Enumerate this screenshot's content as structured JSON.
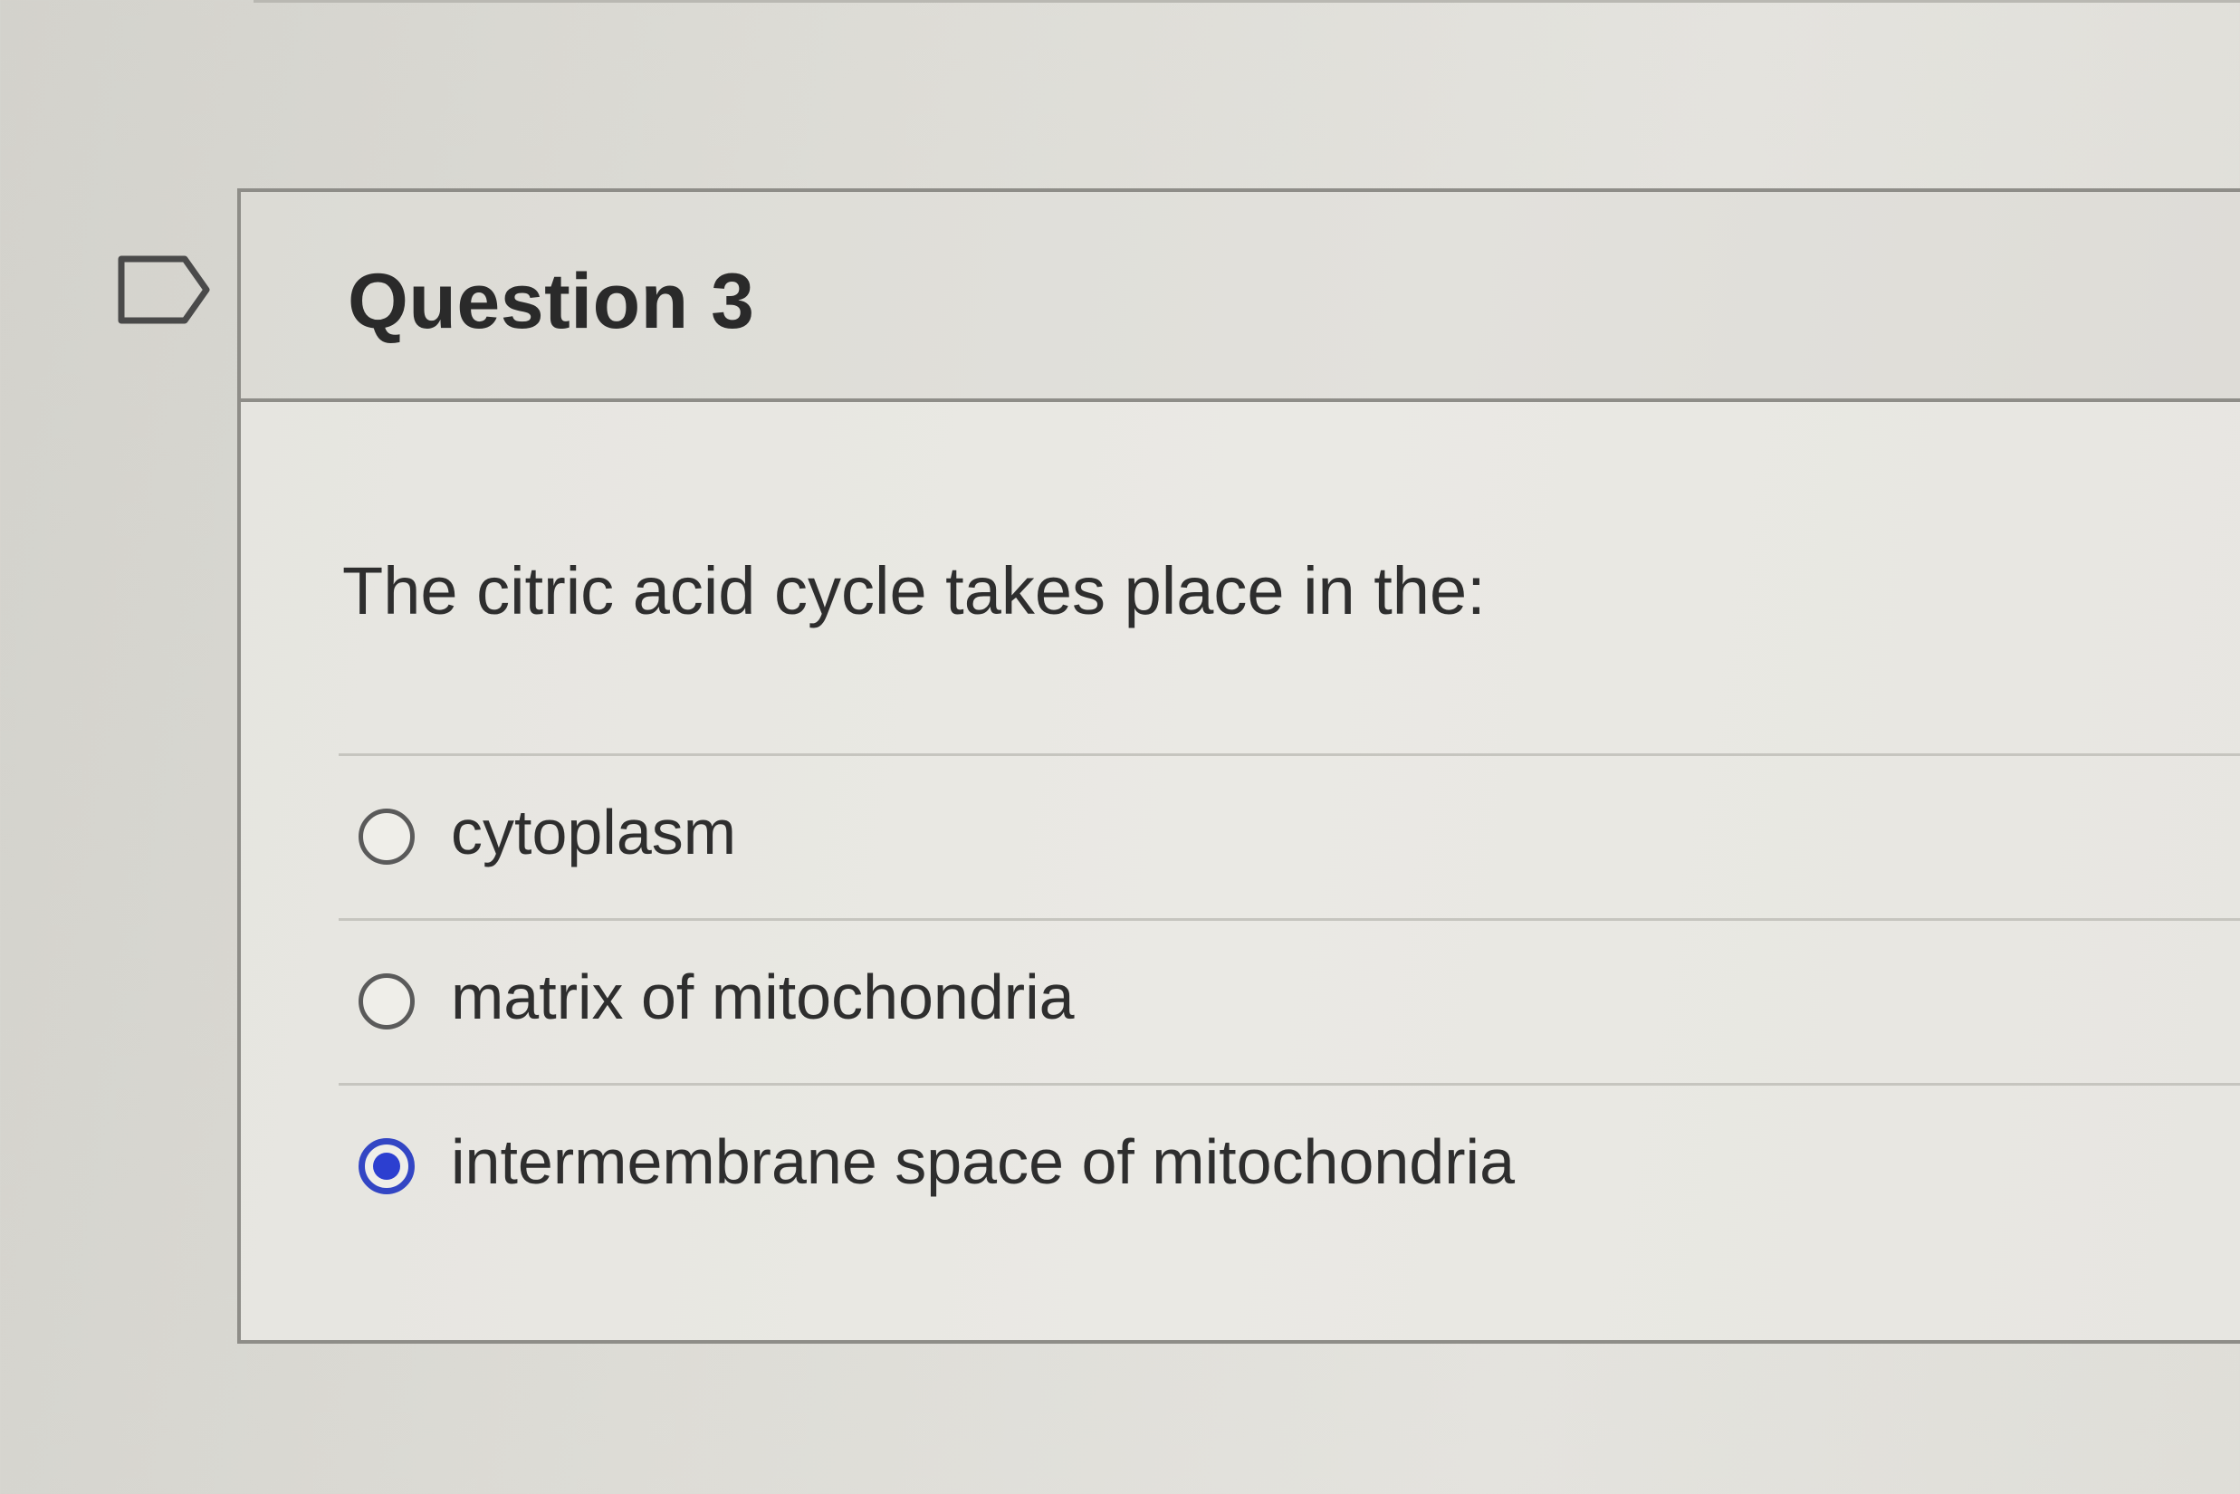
{
  "question": {
    "title": "Question 3",
    "text": "The citric acid cycle takes place in the:",
    "flag_icon": "flag-outline-icon",
    "selected_index": 2,
    "options": [
      {
        "label": "cytoplasm",
        "selected": false
      },
      {
        "label": "matrix of mitochondria",
        "selected": false
      },
      {
        "label": "intermembrane space of mitochondria",
        "selected": true
      }
    ]
  },
  "colors": {
    "accent": "#2c3fd0",
    "border": "#8e8d88"
  }
}
